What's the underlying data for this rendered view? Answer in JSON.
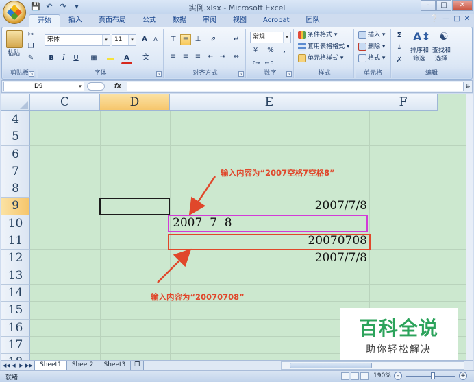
{
  "window": {
    "title": "实例.xlsx - Microsoft Excel",
    "quick_access": [
      "save-icon",
      "undo-icon",
      "redo-icon",
      "customize-icon"
    ]
  },
  "ribbon_tabs": [
    "开始",
    "插入",
    "页面布局",
    "公式",
    "数据",
    "审阅",
    "视图",
    "Acrobat",
    "团队"
  ],
  "active_tab": "开始",
  "ribbon": {
    "clipboard": {
      "label": "剪贴板",
      "paste": "粘贴"
    },
    "font": {
      "label": "字体",
      "font_name": "宋体",
      "font_size": "11",
      "grow": "A",
      "shrink": "A",
      "bold": "B",
      "italic": "I",
      "underline": "U",
      "wen": "文"
    },
    "alignment": {
      "label": "对齐方式"
    },
    "number": {
      "label": "数字",
      "format": "常规",
      "percent": "%",
      "comma": ","
    },
    "styles": {
      "label": "样式",
      "conditional": "条件格式",
      "table": "套用表格格式",
      "cell_styles": "单元格样式"
    },
    "cells": {
      "label": "单元格",
      "insert": "插入",
      "delete": "删除",
      "format": "格式"
    },
    "editing": {
      "label": "编辑",
      "sigma": "Σ",
      "sort": "排序和",
      "sort2": "筛选",
      "find": "查找和",
      "find2": "选择"
    }
  },
  "formula_bar": {
    "name_box": "D9",
    "fx": "fx",
    "content": ""
  },
  "sheet": {
    "columns": [
      "C",
      "D",
      "E",
      "F"
    ],
    "selected_column": "D",
    "rows": [
      "4",
      "5",
      "6",
      "7",
      "8",
      "9",
      "10",
      "11",
      "12",
      "13",
      "14",
      "15",
      "16",
      "17",
      "18"
    ],
    "selected_row": "9",
    "cells": {
      "E9": "2007/7/8",
      "E10": "2007  7  8",
      "E11": "20070708",
      "E12": "2007/7/8"
    },
    "annotation_top": "输入内容为“2007空格7空格8”",
    "annotation_bottom": "输入内容为“20070708”",
    "accent": {
      "magenta": "#d23ad8",
      "red": "#e0472b",
      "sheet_bg": "#cce8cf"
    }
  },
  "watermark": {
    "title": "百科全说",
    "subtitle": "助你轻松解决"
  },
  "sheet_tabs": [
    "Sheet1",
    "Sheet2",
    "Sheet3"
  ],
  "active_sheet": "Sheet1",
  "status": {
    "text": "就绪",
    "zoom": "190%",
    "zoom_fraction": 0.55
  }
}
